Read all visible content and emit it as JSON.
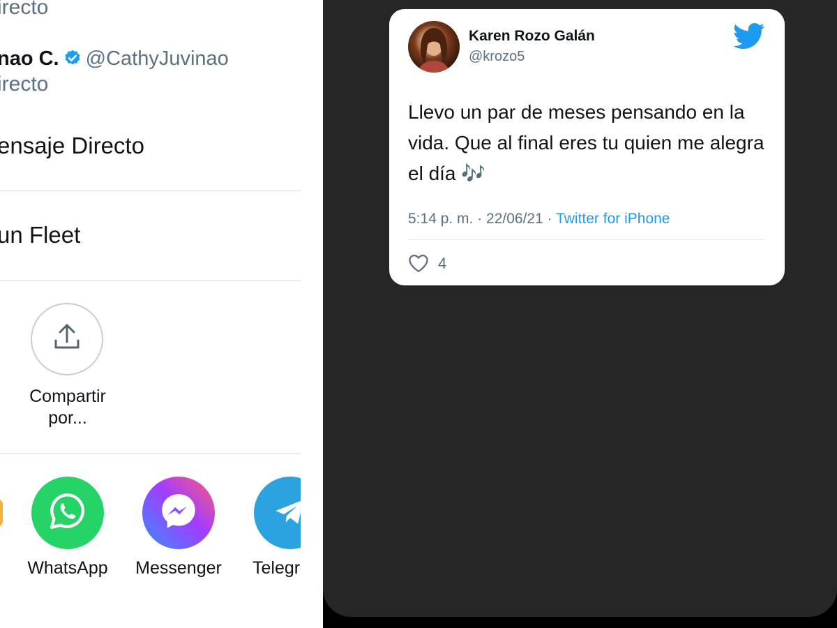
{
  "share_sheet": {
    "dm_subtitle_top": "irecto",
    "contact": {
      "name": "nao C.",
      "handle": "@CathyJuvinao",
      "subtitle": "irecto"
    },
    "dm_row_label": "ensaje Directo",
    "fleet_row_label": "un Fleet",
    "share_via": {
      "line1": "Compartir",
      "line2": "por..."
    },
    "apps": [
      {
        "label": "WhatsApp",
        "color": "#25D366",
        "icon": "whatsapp-icon"
      },
      {
        "label": "Messenger",
        "color": "#7E57F5",
        "icon": "messenger-icon"
      },
      {
        "label": "Telegr",
        "color": "#2AA3E0",
        "icon": "telegram-icon"
      }
    ]
  },
  "tweet": {
    "author_name": "Karen Rozo Galán",
    "author_handle": "@krozo5",
    "text": "Llevo un par de meses pensando en la vida. Que al final eres tu quien me alegra el día 🎶",
    "timestamp": "5:14 p. m. · 22/06/21 · ",
    "source": "Twitter for iPhone",
    "likes": "4",
    "brand_color": "#1D9BF0"
  }
}
